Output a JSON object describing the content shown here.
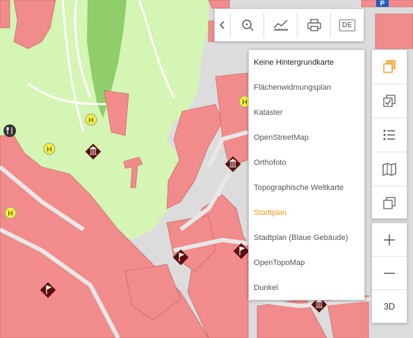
{
  "toolbar": {
    "back_icon": "chevron-left-icon",
    "search_icon": "search-icon",
    "measure_icon": "chart-measure-icon",
    "print_icon": "printer-icon",
    "language": "DE"
  },
  "basemap_menu": {
    "items": [
      "Keine Hintergrundkarte",
      "Flächenwidmungsplan",
      "Kataster",
      "OpenStreetMap",
      "Orthofoto",
      "Topographische Weltkarte",
      "Stadtplan",
      "Stadtplan (Blaue Gebäude)",
      "OpenTopoMap",
      "Dunkel"
    ],
    "active": "Stadtplan"
  },
  "side_panel": {
    "icons": [
      "layers-icon",
      "checkbox-layers-icon",
      "list-icon",
      "map-book-icon",
      "stack-icon"
    ]
  },
  "zoom": {
    "zoom_in": "+",
    "zoom_out": "—",
    "view_3d": "3D"
  },
  "map": {
    "parking_label": "P",
    "helicopter_label": "H",
    "colors": {
      "building": "#f28b8b",
      "park": "#d4f5b3",
      "forest": "#8fce6a",
      "street": "#dcdcdc",
      "accent": "#f29b1d",
      "poi": "#5c0d0d"
    }
  }
}
